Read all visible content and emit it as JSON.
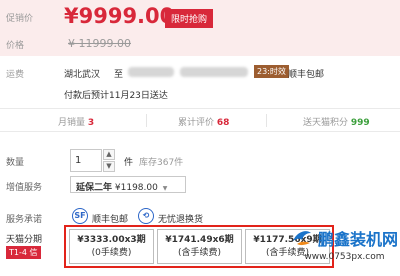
{
  "price": {
    "promo_label": "促销价",
    "promo_price": "¥9999.00",
    "promo_badge": "限时抢购",
    "orig_label": "价格",
    "orig_price": "¥ 11999.00"
  },
  "shipping": {
    "label": "运费",
    "from": "湖北武汉",
    "to": "至",
    "delivery_tag": "23:时效",
    "carrier": "顺丰包邮",
    "note": "付款后预计11月23日送达"
  },
  "stats": {
    "monthly_sales_label": "月销量",
    "monthly_sales": "3",
    "reviews_label": "累计评价",
    "reviews": "68",
    "points_label": "送天猫积分",
    "points": "999"
  },
  "quantity": {
    "label": "数量",
    "value": "1",
    "unit": "件",
    "stock": "库存367件"
  },
  "warranty": {
    "label": "增值服务",
    "option": "延保二年",
    "price": "¥1198.00",
    "arrow": "▼"
  },
  "services": {
    "label": "服务承诺",
    "items": [
      {
        "icon_char": "SF",
        "text": "顺丰包邮",
        "icon": "sf-express-icon"
      },
      {
        "icon_char": "⟲",
        "text": "无忧退换货",
        "icon": "return-icon"
      }
    ]
  },
  "installments": {
    "label": "天猫分期",
    "badge": "T1-4 信",
    "options": [
      {
        "amount": "¥3333.00x3期",
        "fee": "(0手续费)"
      },
      {
        "amount": "¥1741.49x6期",
        "fee": "(含手续费)"
      },
      {
        "amount": "¥1177.56x9期",
        "fee": "(含手续费)"
      }
    ]
  },
  "watermark": {
    "title": "鹏鑫装机网",
    "url": "www.0753px.com"
  },
  "colors": {
    "accent": "#d8283a",
    "price_bg": "#fbecec",
    "green": "#3c9f3c",
    "blue": "#2d67c8"
  }
}
